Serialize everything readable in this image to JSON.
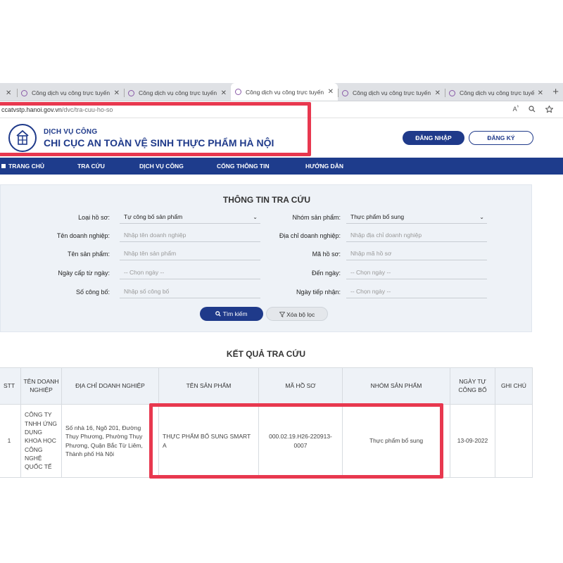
{
  "browser": {
    "tabs": [
      {
        "title": "Công dịch vụ công trực tuyến"
      },
      {
        "title": "Công dịch vụ công trực tuyến"
      },
      {
        "title": "Công dịch vụ công trực tuyến"
      },
      {
        "title": "Công dịch vụ công trực tuyến"
      },
      {
        "title": "Công dịch vụ công trực tuyến"
      }
    ],
    "active_tab_index": 2,
    "url_host": "ccatvstp.hanoi.gov.vn",
    "url_path": "/dvc/tra-cuu-ho-so",
    "icons": [
      "read-aloud-icon",
      "zoom-icon",
      "favorite-icon"
    ]
  },
  "site": {
    "subtitle": "DỊCH VỤ CÔNG",
    "title": "CHI CỤC AN TOÀN VỆ SINH THỰC PHẨM HÀ NỘI",
    "login_label": "ĐĂNG NHẬP",
    "register_label": "ĐĂNG KÝ"
  },
  "nav": {
    "items": [
      {
        "label": "TRANG CHỦ"
      },
      {
        "label": "TRA CỨU"
      },
      {
        "label": "DỊCH VỤ CÔNG"
      },
      {
        "label": "CỔNG THÔNG TIN"
      },
      {
        "label": "HƯỚNG DẪN"
      }
    ],
    "active": "TRA CỨU"
  },
  "search": {
    "title": "THÔNG TIN TRA CỨU",
    "fields": {
      "loai_ho_so": {
        "label": "Loại hồ sơ:",
        "value": "Tự công bố sản phẩm"
      },
      "nhom_san_pham": {
        "label": "Nhóm sản phẩm:",
        "value": "Thực phẩm bổ sung"
      },
      "ten_doanh_nghiep": {
        "label": "Tên doanh nghiệp:",
        "placeholder": "Nhập tên doanh nghiệp"
      },
      "dia_chi_doanh_nghiep": {
        "label": "Địa chỉ doanh nghiệp:",
        "placeholder": "Nhập địa chỉ doanh nghiệp"
      },
      "ten_san_pham": {
        "label": "Tên sản phẩm:",
        "placeholder": "Nhập tên sản phẩm"
      },
      "ma_ho_so": {
        "label": "Mã hồ sơ:",
        "placeholder": "Nhập mã hồ sơ"
      },
      "ngay_cap_tu": {
        "label": "Ngày cấp từ ngày:",
        "placeholder": "-- Chọn ngày --"
      },
      "den_ngay": {
        "label": "Đến ngày:",
        "placeholder": "-- Chọn ngày --"
      },
      "so_cong_bo": {
        "label": "Số công bố:",
        "placeholder": "Nhập số công bố"
      },
      "ngay_tiep_nhan": {
        "label": "Ngày tiếp nhận:",
        "placeholder": "-- Chọn ngày --"
      }
    },
    "search_button": "Tìm kiếm",
    "clear_button": "Xóa bộ lọc"
  },
  "results": {
    "title": "KẾT QUẢ TRA CỨU",
    "columns": [
      "STT",
      "TÊN DOANH NGHIỆP",
      "ĐỊA CHỈ DOANH NGHIỆP",
      "TÊN SẢN PHẨM",
      "MÃ HỒ SƠ",
      "NHÓM SẢN PHẨM",
      "NGÀY TỰ CÔNG BỐ",
      "GHI CHÚ"
    ],
    "rows": [
      {
        "stt": "1",
        "ten_doanh_nghiep": "CÔNG TY TNHH ỨNG DỤNG KHOA HỌC CÔNG NGHỆ QUỐC TẾ",
        "dia_chi": "Số nhà 16, Ngõ 201, Đường Thụy Phương, Phường Thụy Phương, Quận Bắc Từ Liêm, Thành phố Hà Nội",
        "ten_san_pham": "THỰC PHẨM BỔ SUNG SMART A",
        "ma_ho_so": "000.02.19.H26-220913-0007",
        "nhom_san_pham": "Thực phẩm bổ sung",
        "ngay_cong_bo": "13-09-2022",
        "ghi_chu": ""
      }
    ]
  },
  "colors": {
    "brand_blue": "#1f3a8a",
    "nav_blue": "#1e3c8c",
    "highlight_red": "#e8384f",
    "panel_bg": "#eef2f7"
  }
}
